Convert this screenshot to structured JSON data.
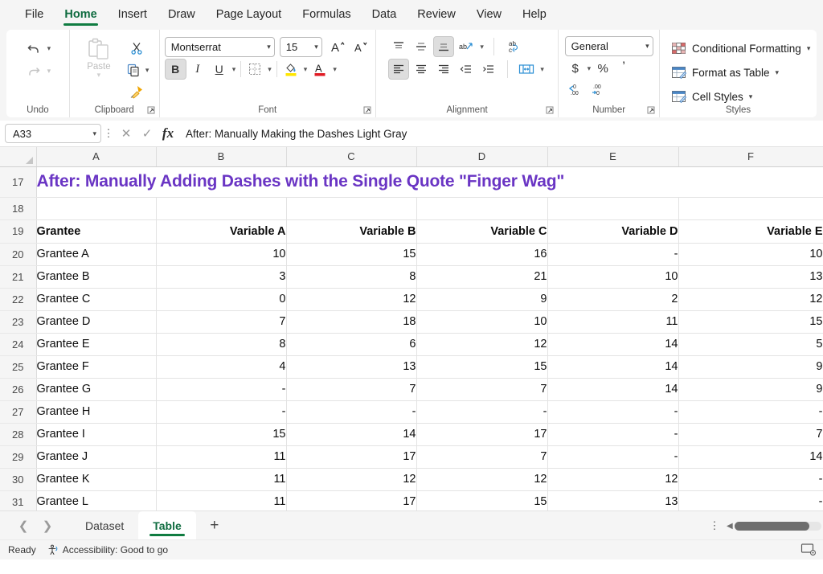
{
  "ribbon": {
    "tabs": [
      {
        "label": "File",
        "active": false
      },
      {
        "label": "Home",
        "active": true
      },
      {
        "label": "Insert",
        "active": false
      },
      {
        "label": "Draw",
        "active": false
      },
      {
        "label": "Page Layout",
        "active": false
      },
      {
        "label": "Formulas",
        "active": false
      },
      {
        "label": "Data",
        "active": false
      },
      {
        "label": "Review",
        "active": false
      },
      {
        "label": "View",
        "active": false
      },
      {
        "label": "Help",
        "active": false
      }
    ],
    "groups": {
      "undo": {
        "label": "Undo",
        "undo_icon": "undo-arrow-icon",
        "redo_icon": "redo-arrow-icon"
      },
      "clipboard": {
        "label": "Clipboard",
        "paste_label": "Paste",
        "paste_icon": "clipboard-icon",
        "cut_icon": "scissors-icon",
        "copy_icon": "copy-icon",
        "format_painter_icon": "paintbrush-icon",
        "launcher_icon": "dialog-launcher-icon"
      },
      "font": {
        "label": "Font",
        "font_name": "Montserrat",
        "font_size": "15",
        "grow_font_icon": "grow-font-icon",
        "shrink_font_icon": "shrink-font-icon",
        "bold_label": "B",
        "italic_label": "I",
        "underline_label": "U",
        "borders_icon": "borders-icon",
        "fill_color_icon": "fill-color-icon",
        "font_color_icon": "font-color-icon",
        "launcher_icon": "dialog-launcher-icon",
        "fill_color": "#ffe600",
        "font_color": "#e01b24"
      },
      "alignment": {
        "label": "Alignment",
        "top_align_icon": "align-top-icon",
        "middle_align_icon": "align-middle-icon",
        "bottom_align_icon": "align-bottom-icon",
        "orientation_icon": "text-orientation-icon",
        "wrap_text_icon": "wrap-text-icon",
        "align_left_icon": "align-left-icon",
        "align_center_icon": "align-center-icon",
        "align_right_icon": "align-right-icon",
        "decrease_indent_icon": "decrease-indent-icon",
        "increase_indent_icon": "increase-indent-icon",
        "merge_center_icon": "merge-and-center-icon",
        "launcher_icon": "dialog-launcher-icon"
      },
      "number": {
        "label": "Number",
        "format": "General",
        "currency_label": "$",
        "percent_label": "%",
        "comma_label": "’",
        "increase_decimal_icon": "increase-decimal-icon",
        "decrease_decimal_icon": "decrease-decimal-icon",
        "launcher_icon": "dialog-launcher-icon"
      },
      "styles": {
        "label": "Styles",
        "items": [
          {
            "label": "Conditional Formatting",
            "icon": "conditional-formatting-icon"
          },
          {
            "label": "Format as Table",
            "icon": "format-as-table-icon"
          },
          {
            "label": "Cell Styles",
            "icon": "cell-styles-icon"
          }
        ]
      }
    }
  },
  "formula_bar": {
    "name_box": "A33",
    "cancel_icon": "cancel-x-icon",
    "enter_icon": "confirm-check-icon",
    "fx_label": "fx",
    "content": "After: Manually Making the Dashes Light Gray"
  },
  "grid": {
    "columns": [
      "A",
      "B",
      "C",
      "D",
      "E",
      "F"
    ],
    "title_row": {
      "num": "17",
      "text": "After: Manually Adding Dashes with the Single Quote \"Finger Wag\"",
      "color": "#6a35c4"
    },
    "blank_row": {
      "num": "18"
    },
    "header_row": {
      "num": "19",
      "cells": [
        "Grantee",
        "Variable A",
        "Variable B",
        "Variable C",
        "Variable D",
        "Variable E"
      ]
    },
    "rows": [
      {
        "num": "20",
        "cells": [
          "Grantee A",
          "10",
          "15",
          "16",
          "-",
          "10"
        ]
      },
      {
        "num": "21",
        "cells": [
          "Grantee B",
          "3",
          "8",
          "21",
          "10",
          "13"
        ]
      },
      {
        "num": "22",
        "cells": [
          "Grantee C",
          "0",
          "12",
          "9",
          "2",
          "12"
        ]
      },
      {
        "num": "23",
        "cells": [
          "Grantee D",
          "7",
          "18",
          "10",
          "11",
          "15"
        ]
      },
      {
        "num": "24",
        "cells": [
          "Grantee E",
          "8",
          "6",
          "12",
          "14",
          "5"
        ]
      },
      {
        "num": "25",
        "cells": [
          "Grantee F",
          "4",
          "13",
          "15",
          "14",
          "9"
        ]
      },
      {
        "num": "26",
        "cells": [
          "Grantee G",
          "-",
          "7",
          "7",
          "14",
          "9"
        ]
      },
      {
        "num": "27",
        "cells": [
          "Grantee H",
          "-",
          "-",
          "-",
          "-",
          "-"
        ]
      },
      {
        "num": "28",
        "cells": [
          "Grantee I",
          "15",
          "14",
          "17",
          "-",
          "7"
        ]
      },
      {
        "num": "29",
        "cells": [
          "Grantee J",
          "11",
          "17",
          "7",
          "-",
          "14"
        ]
      },
      {
        "num": "30",
        "cells": [
          "Grantee K",
          "11",
          "12",
          "12",
          "12",
          "-"
        ]
      },
      {
        "num": "31",
        "cells": [
          "Grantee L",
          "11",
          "17",
          "15",
          "13",
          "-"
        ]
      }
    ]
  },
  "sheet_bar": {
    "prev_icon": "chevron-left-icon",
    "next_icon": "chevron-right-icon",
    "tabs": [
      {
        "label": "Dataset",
        "active": false
      },
      {
        "label": "Table",
        "active": true
      }
    ],
    "add_label": "+",
    "more_icon": "more-vertical-icon",
    "scroll_left_icon": "scroll-left-icon"
  },
  "status_bar": {
    "mode": "Ready",
    "accessibility": "Accessibility: Good to go",
    "accessibility_icon": "accessibility-icon",
    "display_settings_icon": "display-settings-icon"
  }
}
